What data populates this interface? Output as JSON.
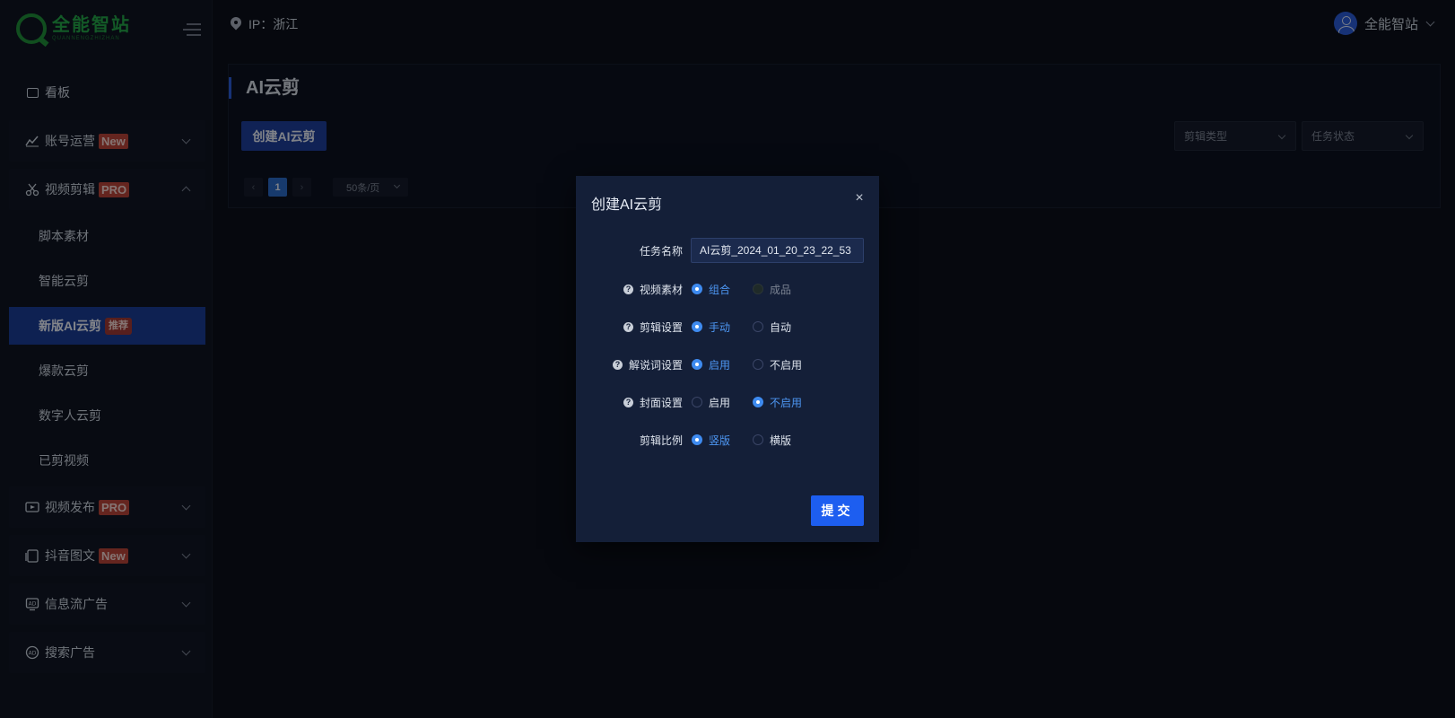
{
  "brand": {
    "name": "全能智站",
    "subtitle": "QUANNENGZHIZHAN"
  },
  "header": {
    "location": "IP：浙江",
    "username": "全能智站"
  },
  "sidebar": {
    "items": [
      {
        "label": "看板"
      },
      {
        "label": "账号运营",
        "badge": "New"
      },
      {
        "label": "视频剪辑",
        "badge": "PRO"
      },
      {
        "label": "视频发布",
        "badge": "PRO"
      },
      {
        "label": "抖音图文",
        "badge": "New"
      },
      {
        "label": "信息流广告"
      },
      {
        "label": "搜索广告"
      }
    ],
    "subitems": [
      {
        "label": "脚本素材"
      },
      {
        "label": "智能云剪"
      },
      {
        "label": "新版AI云剪",
        "badge": "推荐"
      },
      {
        "label": "爆款云剪"
      },
      {
        "label": "数字人云剪"
      },
      {
        "label": "已剪视频"
      }
    ]
  },
  "main": {
    "title": "AI云剪",
    "create_button": "创建AI云剪",
    "filters": {
      "clip_type": "剪辑类型",
      "task_status": "任务状态"
    },
    "pagination": {
      "prev": "‹",
      "current_page": "1",
      "next": "›",
      "page_size": "50条/页"
    }
  },
  "dialog": {
    "title": "创建AI云剪",
    "close": "×",
    "fields": {
      "task_name": {
        "label": "任务名称",
        "value": "AI云剪_2024_01_20_23_22_53"
      },
      "video_material": {
        "label": "视频素材",
        "opt1": "组合",
        "opt2": "成品",
        "selected": "组合"
      },
      "clip_setting": {
        "label": "剪辑设置",
        "opt1": "手动",
        "opt2": "自动",
        "selected": "手动"
      },
      "narration_setting": {
        "label": "解说词设置",
        "opt1": "启用",
        "opt2": "不启用",
        "selected": "启用"
      },
      "cover_setting": {
        "label": "封面设置",
        "opt1": "启用",
        "opt2": "不启用",
        "selected": "不启用"
      },
      "aspect_ratio": {
        "label": "剪辑比例",
        "opt1": "竖版",
        "opt2": "横版",
        "selected": "竖版"
      }
    },
    "help_icon": "?",
    "submit_label": "提交"
  },
  "colors": {
    "accent": "#1d5ef0",
    "active_nav": "#1b3c95",
    "badge": "#b9443a",
    "radio_on": "#3e8bf0",
    "brand": "#23a548"
  }
}
